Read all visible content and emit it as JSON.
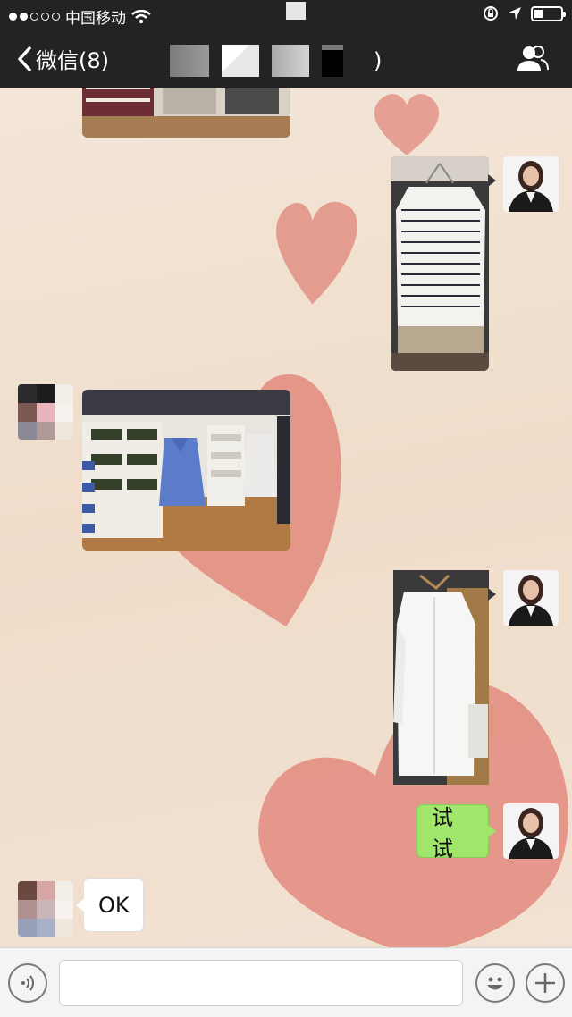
{
  "status_bar": {
    "carrier": "中国移动",
    "signal_full": 2,
    "signal_empty": 3,
    "battery_level": 0.25
  },
  "nav": {
    "back_label": "微信(8)",
    "title_suffix": ")"
  },
  "messages": [
    {
      "id": "m1",
      "side": "left",
      "type": "image",
      "subject": "clothing store shelves (cut off at top)"
    },
    {
      "id": "m2",
      "side": "right",
      "type": "image",
      "subject": "striped sweater on hanger"
    },
    {
      "id": "m3",
      "side": "left",
      "type": "image",
      "subject": "store display with blue shirts and shelves"
    },
    {
      "id": "m4",
      "side": "right",
      "type": "image",
      "subject": "white shirt on hanger"
    },
    {
      "id": "m5",
      "side": "right",
      "type": "text",
      "text": "试试"
    },
    {
      "id": "m6",
      "side": "left",
      "type": "text",
      "text": "OK"
    }
  ],
  "input_bar": {
    "voice_icon": "voice-icon",
    "emoji_icon": "emoji-icon",
    "plus_icon": "plus-icon",
    "placeholder": ""
  },
  "colors": {
    "header": "#232326",
    "background": "#f1e2d3",
    "green_bubble": "#9fe66a",
    "heart": "#e28f82"
  }
}
